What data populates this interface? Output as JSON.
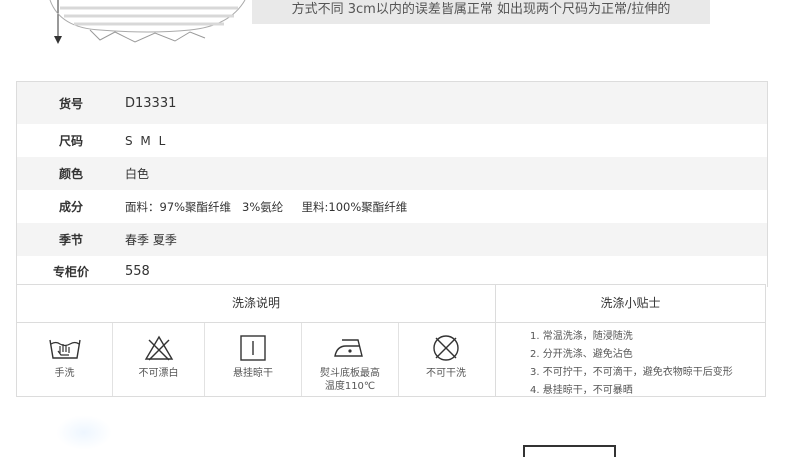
{
  "note": "方式不同 3cm以内的误差皆属正常 如出现两个尺码为正常/拉伸的",
  "specs": [
    {
      "label": "货号",
      "value": "D13331"
    },
    {
      "label": "尺码",
      "value": "S  M  L"
    },
    {
      "label": "颜色",
      "value": "白色"
    },
    {
      "label": "成分",
      "value": "面料：97%聚酯纤维   3%氨纶     里料:100%聚酯纤维"
    },
    {
      "label": "季节",
      "value": "春季 夏季"
    },
    {
      "label": "专柜价",
      "value": "558"
    }
  ],
  "wash": {
    "header": "洗涤说明",
    "items": [
      {
        "icon": "hand-wash-icon",
        "label": "手洗"
      },
      {
        "icon": "no-bleach-icon",
        "label": "不可漂白"
      },
      {
        "icon": "hang-dry-icon",
        "label": "悬挂晾干"
      },
      {
        "icon": "iron-icon",
        "label": "熨斗底板最高温度110℃"
      },
      {
        "icon": "no-dry-clean-icon",
        "label": "不可干洗"
      }
    ]
  },
  "tips": {
    "header": "洗涤小贴士",
    "items": [
      "1. 常温洗涤，随浸随洗",
      "2. 分开洗涤、避免沾色",
      "3. 不可拧干，不可滴干，避免衣物晾干后变形",
      "4. 悬挂晾干，不可暴晒"
    ]
  }
}
